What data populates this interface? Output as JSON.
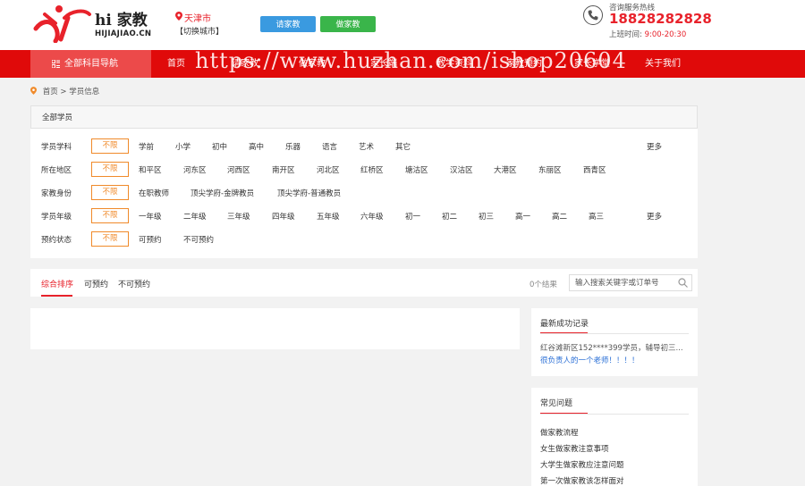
{
  "header": {
    "logo_title": "hi 家教",
    "logo_sub": "HIJIAJIAO.CN",
    "city": "天津市",
    "city_switch": "【切换城市】",
    "btn_find_teacher": "请家教",
    "btn_be_teacher": "做家教",
    "hotline_label": "咨询服务热线",
    "hotline_number": "18828282828",
    "hours_label": "上班时间:",
    "hours": "9:00-20:30"
  },
  "nav": {
    "all_label": "全部科目导航",
    "items": [
      "首页",
      "请家教",
      "做家教",
      "家长端",
      "教学资料",
      "家教预约",
      "家长学堂",
      "关于我们"
    ],
    "watermark": "https://www.huzhan.com/ishop20604"
  },
  "breadcrumb": {
    "home": "首页",
    "sep": ">",
    "current": "学员信息"
  },
  "filter": {
    "header": "全部学员",
    "no_limit": "不限",
    "more": "更多",
    "rows": [
      {
        "label": "学员学科",
        "options": [
          "学前",
          "小学",
          "初中",
          "高中",
          "乐器",
          "语言",
          "艺术",
          "其它"
        ],
        "more": true
      },
      {
        "label": "所在地区",
        "options": [
          "和平区",
          "河东区",
          "河西区",
          "南开区",
          "河北区",
          "红桥区",
          "塘沽区",
          "汉沽区",
          "大港区",
          "东丽区",
          "西青区"
        ],
        "more": false
      },
      {
        "label": "家教身份",
        "options": [
          "在职教师",
          "顶尖学府-金牌教员",
          "顶尖学府-普通教员"
        ],
        "more": false
      },
      {
        "label": "学员年级",
        "options": [
          "一年级",
          "二年级",
          "三年级",
          "四年级",
          "五年级",
          "六年级",
          "初一",
          "初二",
          "初三",
          "高一",
          "高二",
          "高三"
        ],
        "more": true
      },
      {
        "label": "预约状态",
        "options": [
          "可预约",
          "不可预约"
        ],
        "more": false
      }
    ]
  },
  "sortbar": {
    "tabs": [
      "综合排序",
      "可预约",
      "不可预约"
    ],
    "result_count": "0个结果",
    "search_placeholder": "输入搜索关键字或订单号"
  },
  "sidebar": {
    "recent_title": "最新成功记录",
    "recent_line1": "红谷滩新区152****399学员，辅导初三...",
    "recent_line2": "很负责人的一个老师！！！！",
    "faq_title": "常见问题",
    "faq_items": [
      "做家教流程",
      "女生做家教注意事项",
      "大学生做家教应注意问题",
      "第一次做家教该怎样面对"
    ]
  },
  "colors": {
    "brand_red": "#e00a0a",
    "accent_orange": "#f08a2a",
    "btn_blue": "#3a9ae0",
    "btn_green": "#3ab54a"
  }
}
